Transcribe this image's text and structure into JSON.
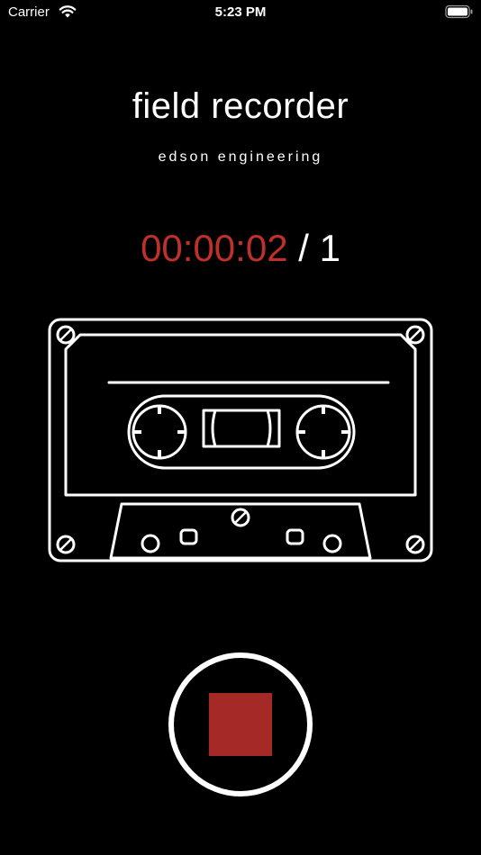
{
  "status_bar": {
    "carrier": "Carrier",
    "time": "5:23 PM"
  },
  "app": {
    "title": "field recorder",
    "subtitle": "edson engineering"
  },
  "timer": {
    "elapsed": "00:00:02",
    "separator": "/",
    "count": "1"
  },
  "icons": {
    "wifi": "wifi-icon",
    "battery": "battery-icon",
    "cassette": "cassette-tape-icon",
    "stop": "stop-icon"
  },
  "colors": {
    "background": "#000000",
    "foreground": "#ffffff",
    "accent": "#c0302a",
    "stop_square": "#a52a26"
  }
}
